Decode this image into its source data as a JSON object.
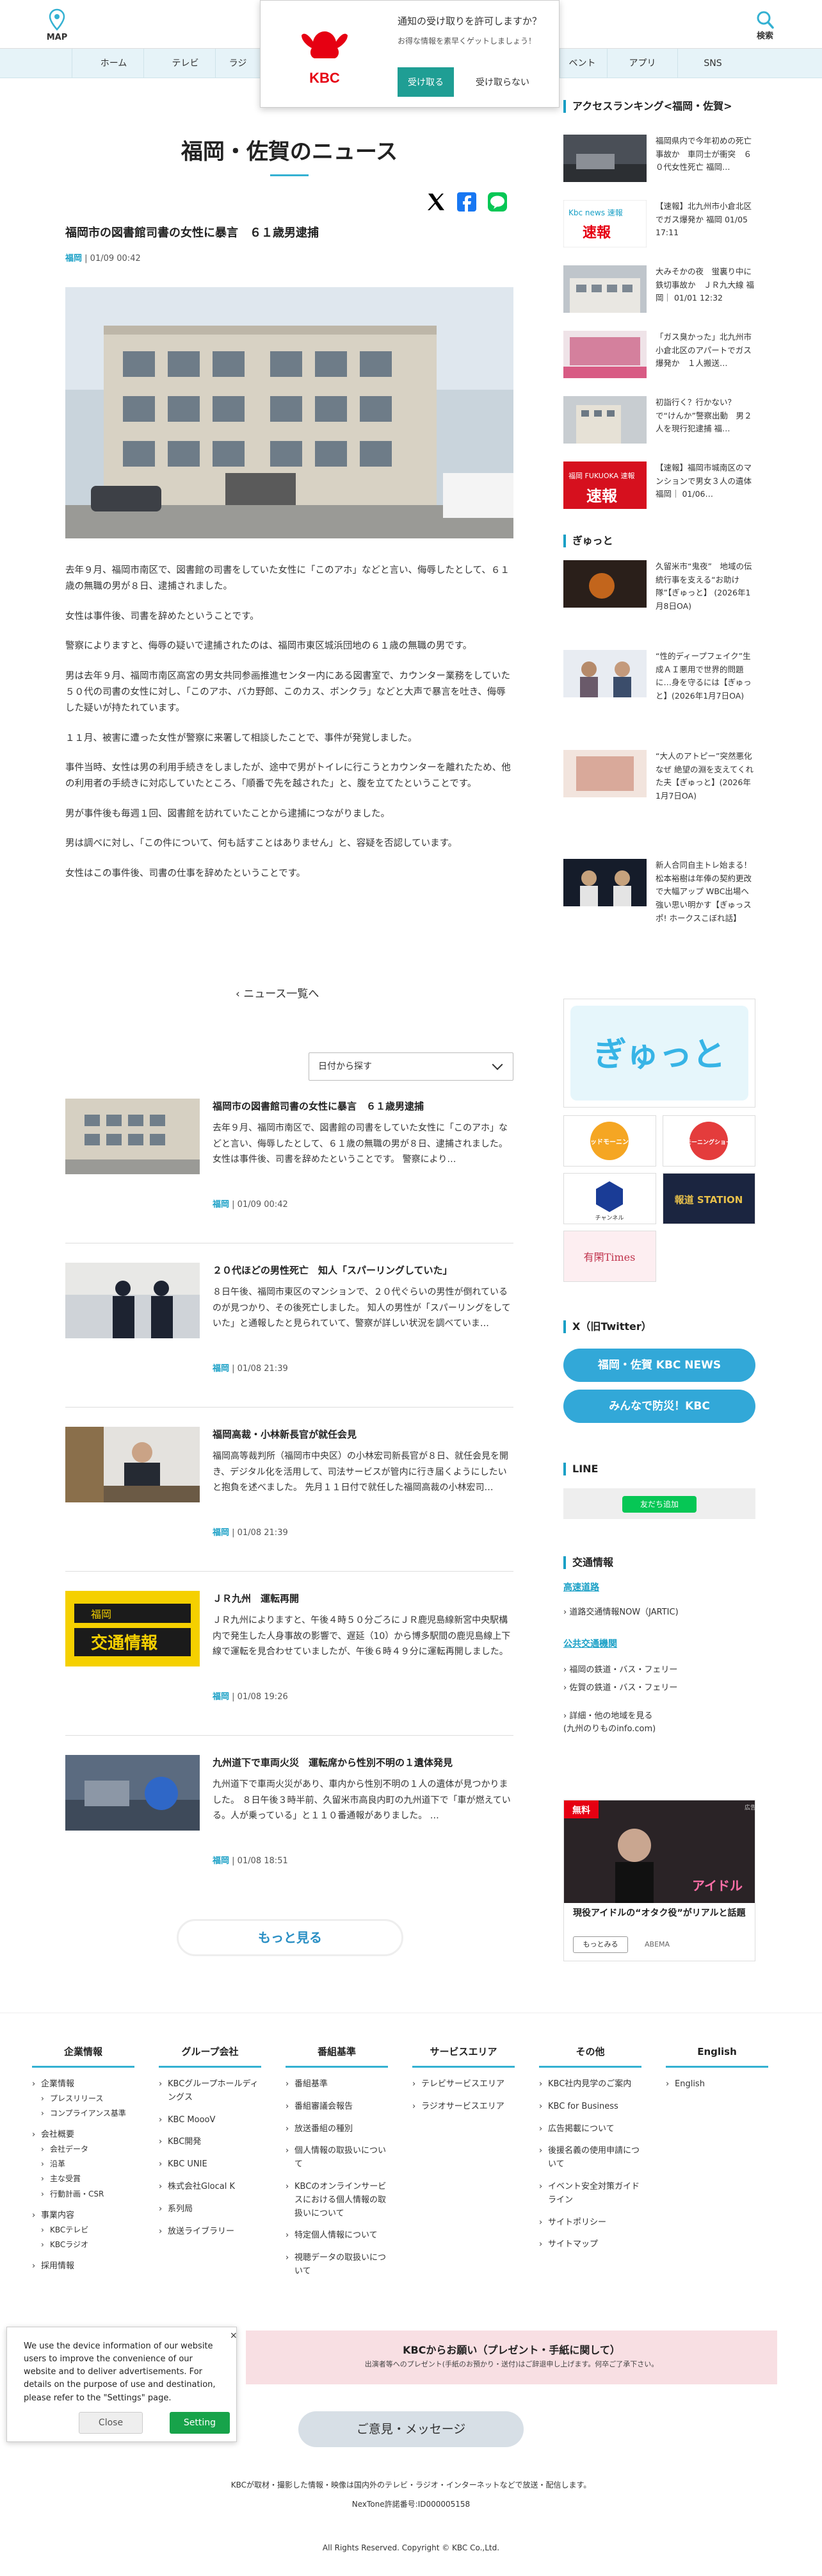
{
  "header": {
    "map_label": "MAP",
    "search_label": "検索",
    "nav": [
      "ホーム",
      "テレビ",
      "ラジ",
      "ベント",
      "アプリ",
      "SNS"
    ]
  },
  "notification": {
    "title": "通知の受け取りを許可しますか？",
    "subtitle": "お得な情報を素早くゲットしましょう！",
    "accept": "受け取る",
    "deny": "受け取らない",
    "logo_text": "KBC"
  },
  "page": {
    "title": "福岡・佐賀のニュース"
  },
  "article": {
    "title": "福岡市の図書館司書の女性に暴言　６１歳男逮捕",
    "category": "福岡",
    "date": "01/09 00:42",
    "paragraphs": [
      "去年９月、福岡市南区で、図書館の司書をしていた女性に「このアホ」などと言い、侮辱したとして、６１歳の無職の男が８日、逮捕されました。",
      "女性は事件後、司書を辞めたということです。",
      "警察によりますと、侮辱の疑いで逮捕されたのは、福岡市東区城浜団地の６１歳の無職の男です。",
      "男は去年９月、福岡市南区高宮の男女共同参画推進センター内にある図書室で、カウンター業務をしていた５０代の司書の女性に対し、「このアホ、バカ野郎、このカス、ボンクラ」などと大声で暴言を吐き、侮辱した疑いが持たれています。",
      "１１月、被害に遭った女性が警察に来署して相談したことで、事件が発覚しました。",
      "事件当時、女性は男の利用手続きをしましたが、途中で男がトイレに行こうとカウンターを離れたため、他の利用者の手続きに対応していたところ、「順番で先を越された」と、腹を立てたということです。",
      "男が事件後も毎週１回、図書館を訪れていたことから逮捕につながりました。",
      "男は調べに対し、「この件について、何も話すことはありません」と、容疑を否認しています。",
      "女性はこの事件後、司書の仕事を辞めたということです。"
    ]
  },
  "back_link": "ニュース一覧へ",
  "date_select": "日付から探す",
  "news_list": [
    {
      "title": "福岡市の図書館司書の女性に暴言　６１歳男逮捕",
      "desc": "去年９月、福岡市南区で、図書館の司書をしていた女性に「このアホ」などと言い、侮辱したとして、６１歳の無職の男が８日、逮捕されました。 女性は事件後、司書を辞めたということです。 警察により…",
      "category": "福岡",
      "date": "01/09 00:42"
    },
    {
      "title": "２０代ほどの男性死亡　知人「スパーリングしていた」",
      "desc": "８日午後、福岡市東区のマンションで、２０代ぐらいの男性が倒れているのが見つかり、その後死亡しました。 知人の男性が「スパーリングをしていた」と通報したと見られていて、警察が詳しい状況を調べていま…",
      "category": "福岡",
      "date": "01/08 21:39"
    },
    {
      "title": "福岡高裁・小林新長官が就任会見",
      "desc": "福岡高等裁判所（福岡市中央区）の小林宏司新長官が８日、就任会見を開き、デジタル化を活用して、司法サービスが管内に行き届くようにしたいと抱負を述べました。 先月１１日付で就任した福岡高裁の小林宏司…",
      "category": "福岡",
      "date": "01/08 21:39"
    },
    {
      "title": "ＪＲ九州　運転再開",
      "desc": "ＪＲ九州によりますと、午後４時５０分ごろにＪＲ鹿児島線新宮中央駅構内で発生した人身事故の影響で、遅延（10）から博多駅間の鹿児島線上下線で運転を見合わせていましたが、午後６時４９分に運転再開しました。",
      "category": "福岡",
      "date": "01/08 19:26"
    },
    {
      "title": "九州道下で車両火災　運転席から性別不明の１遺体発見",
      "desc": "九州道下で車両火災があり、車内から性別不明の１人の遺体が見つかりました。 ８日午後３時半前、久留米市高良内町の九州道下で「車が燃えている。人が乗っている」と１１０番通報がありました。 …",
      "category": "福岡",
      "date": "01/08 18:51"
    }
  ],
  "more_button": "もっと見る",
  "sidebar": {
    "ranking_title": "アクセスランキング<福岡・佐賀>",
    "ranking": [
      {
        "text": "福岡県内で今年初めの死亡事故か　車同士が衝突　６０代女性死亡 福岡…"
      },
      {
        "text": "【速報】北九州市小倉北区でガス爆発か 福岡 01/05 17:11"
      },
      {
        "text": "大みそかの夜　蛍裏り中に鉄切事故か　ＪＲ九大線 福岡｜ 01/01 12:32"
      },
      {
        "text": "「ガス臭かった」北九州市小倉北区のアパートでガス爆発か　１人搬送…"
      },
      {
        "text": "初詣行く？行かない？で“けんか”警察出動　男２人を現行犯逮捕 福…"
      },
      {
        "text": "【速報】福岡市城南区のマンションで男女３人の遺体 福岡｜ 01/06…"
      }
    ],
    "ranking_badges": [
      "Kbc news 速報",
      "福岡 FUKUOKA 速報"
    ],
    "gyutto_title": "ぎゅっと",
    "gyutto": [
      {
        "text": "久留米市“鬼夜”　地域の伝統行事を支える“お助け隊”【ぎゅっと】 (2026年1月8日OA)"
      },
      {
        "text": "“性的ディープフェイク”生成ＡＩ悪用で世界的問題に…身を守るには【ぎゅっと】(2026年1月7日OA)"
      },
      {
        "text": "“大人のアトピー”突然悪化なぜ 絶望の淵を支えてくれた夫【ぎゅっと】(2026年1月7日OA)"
      },
      {
        "text": "新人合同自主トレ始まる！松本裕樹は年俸の契約更改で大幅アップ WBC出場へ強い思い明かす【ぎゅっスポ! ホークスこぼれ話】"
      }
    ],
    "banners": {
      "gyutto": "ぎゅっと",
      "goodmorning": "グッドモーニング",
      "asamo": "モーニングショー",
      "channel": "チャンネル",
      "hodo": "報道 STATION",
      "yuukan": "有閑Times"
    },
    "twitter_title": "X（旧Twitter）",
    "twitter_buttons": [
      "福岡・佐賀 KBC NEWS",
      "みんなで防災！KBC"
    ],
    "line_title": "LINE",
    "line_button": "友だち追加",
    "traffic_title": "交通情報",
    "traffic_road": "高速道路",
    "traffic_road_link": "道路交通情報NOW（JARTIC)",
    "traffic_public": "公共交通機関",
    "traffic_public_links": [
      "福岡の鉄道・バス・フェリー",
      "佐賀の鉄道・バス・フェリー"
    ],
    "traffic_detail": "詳細・他の地域を見る\n(九州のりものinfo.com)",
    "ad": {
      "badge": "無料",
      "title": "現役アイドルの“オタク役”がリアルと話題",
      "btn": "もっとみる",
      "brand": "ABEMA",
      "label": "広告"
    }
  },
  "footer": {
    "cols": [
      {
        "title": "企業情報",
        "items": [
          "企業情報",
          "プレスリリース",
          "コンプライアンス基準",
          "会社概要",
          "会社データ",
          "沿革",
          "主な受賞",
          "行動計画・CSR",
          "事業内容",
          "KBCテレビ",
          "KBCラジオ",
          "採用情報"
        ]
      },
      {
        "title": "グループ会社",
        "items": [
          "KBCグループホールディングス",
          "KBC MoooV",
          "KBC開発",
          "KBC UNIE",
          "株式会社Glocal K",
          "系列局",
          "放送ライブラリー"
        ]
      },
      {
        "title": "番組基準",
        "items": [
          "番組基準",
          "番組審議会報告",
          "放送番組の種別",
          "個人情報の取扱いについて",
          "KBCのオンラインサービスにおける個人情報の取扱いについて",
          "特定個人情報について",
          "視聴データの取扱いについて"
        ]
      },
      {
        "title": "サービスエリア",
        "items": [
          "テレビサービスエリア",
          "ラジオサービスエリア"
        ]
      },
      {
        "title": "その他",
        "items": [
          "KBC社内見学のご案内",
          "KBC for Business",
          "広告掲載について",
          "後援名義の使用申請について",
          "イベント安全対策ガイドライン",
          "サイトポリシー",
          "サイトマップ"
        ]
      },
      {
        "title": "English",
        "items": [
          "English"
        ]
      }
    ],
    "request_title": "KBCからお願い（プレゼント・手紙に関して）",
    "request_sub": "出演者等へのプレゼント(手紙のお預かり・送付)はご辞退申し上げます。何卒ご了承下さい。",
    "opinion": "ご意見・メッセージ",
    "note": "KBCが取材・撮影した情報・映像は国内外のテレビ・ラジオ・インターネットなどで放送・配信します。",
    "newtone": "NexTone許諾番号:ID000005158",
    "copyright": "All Rights Reserved. Copyright © KBC Co.,Ltd."
  },
  "cookie": {
    "text": "We use the device information of our website users to improve the convenience of our website and to deliver advertisements. For details on the purpose of use and destination, please refer to the \"Settings\" page.",
    "close": "Close",
    "setting": "Setting"
  },
  "colors": {
    "accent": "#34b1d2",
    "link": "#1aa0c6",
    "line": "#06c755",
    "twitter": "#32a8d8"
  }
}
